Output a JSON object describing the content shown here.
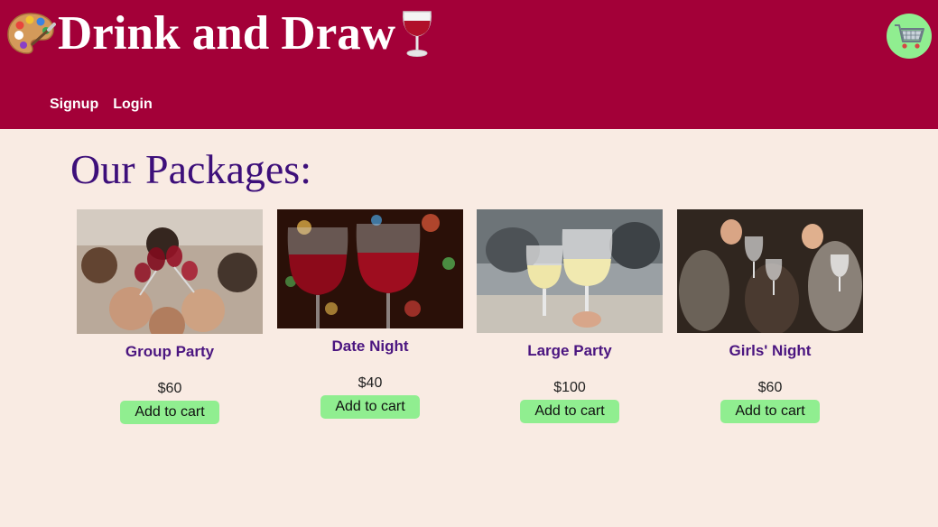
{
  "header": {
    "title": "Drink and Draw",
    "left_icon": "artist-palette-emoji",
    "right_icon": "wine-glass-emoji",
    "cart_icon": "shopping-cart-icon",
    "background_color": "#a30038",
    "cart_color": "#90ee90"
  },
  "nav": {
    "signup_label": "Signup",
    "login_label": "Login"
  },
  "main": {
    "title": "Our Packages:",
    "packages": [
      {
        "name": "Group Party",
        "price": "$60",
        "button_label": "Add to cart",
        "image": "group-toasting-wine-photo"
      },
      {
        "name": "Date Night",
        "price": "$40",
        "button_label": "Add to cart",
        "image": "two-red-wine-glasses-photo"
      },
      {
        "name": "Large Party",
        "price": "$100",
        "button_label": "Add to cart",
        "image": "white-wine-toast-photo"
      },
      {
        "name": "Girls' Night",
        "price": "$60",
        "button_label": "Add to cart",
        "image": "friends-toasting-photo"
      }
    ]
  },
  "colors": {
    "page_background": "#f9ebe3",
    "title_color": "#3d0f7a",
    "package_name_color": "#4b1580",
    "button_color": "#90ee90"
  }
}
